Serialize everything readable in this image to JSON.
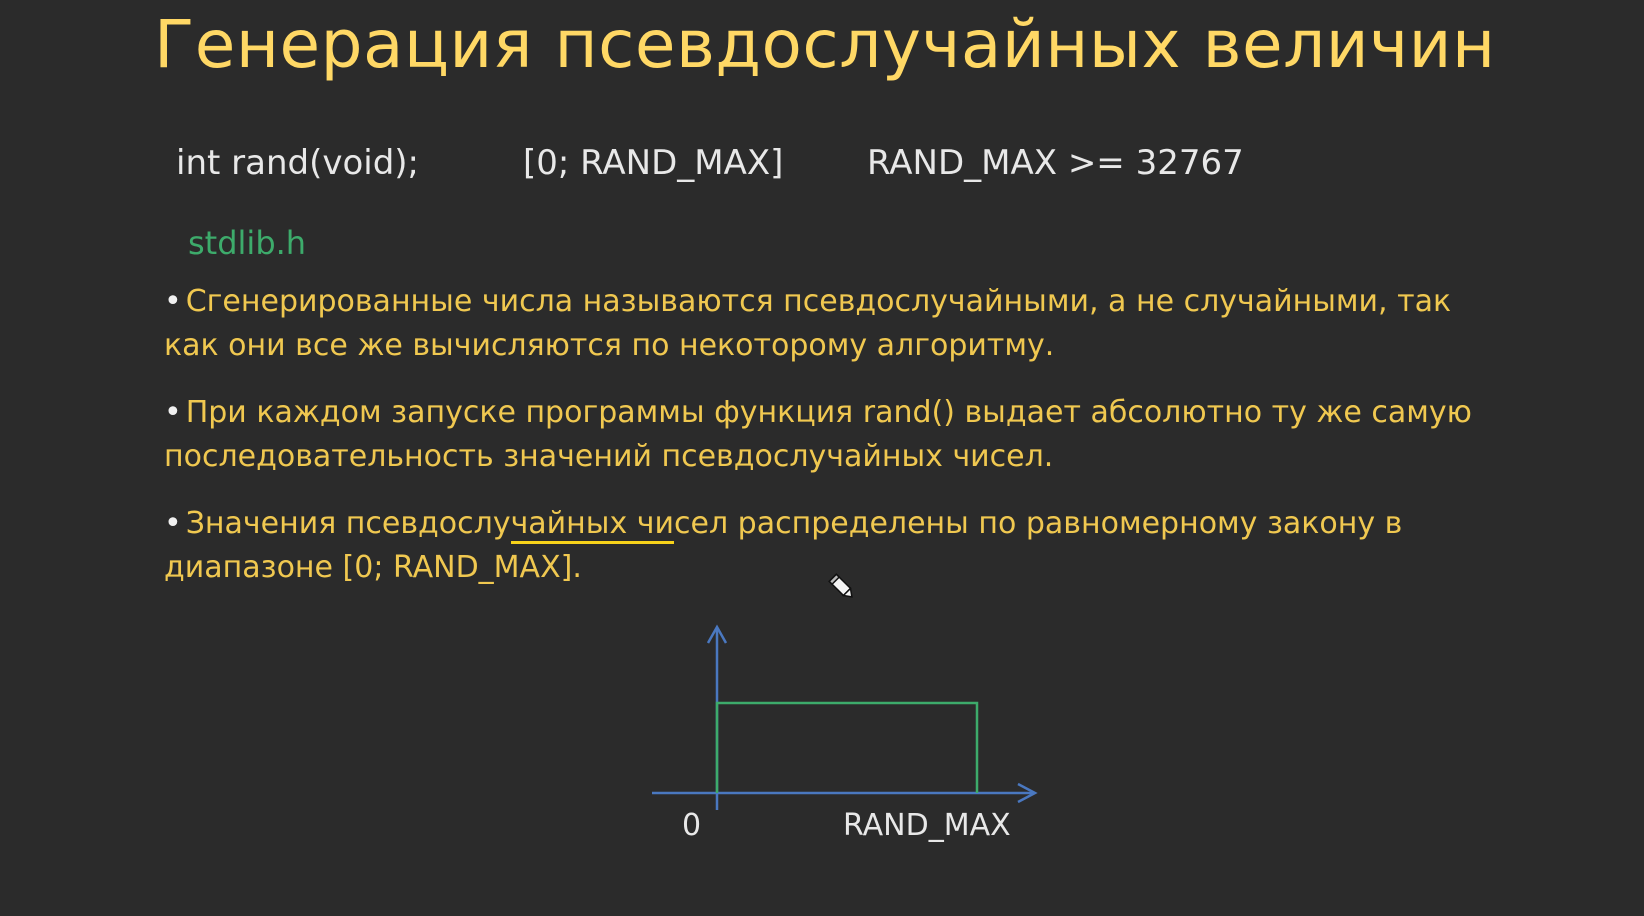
{
  "slide": {
    "title": "Генерация псевдослучайных величин",
    "code": {
      "signature": "int rand(void);",
      "range": "[0; RAND_MAX]",
      "constraint": "RAND_MAX >= 32767"
    },
    "header_file": "stdlib.h",
    "bullets": [
      {
        "text": "Сгенерированные числа называются псевдослучайными, а не случайными, так как они все же вычисляются по некоторому алгоритму."
      },
      {
        "text": "При каждом запуске программы функция rand() выдает абсолютно ту же самую последовательность значений псевдослучайных чисел."
      },
      {
        "before": "Значения псевдослу",
        "highlight": "чайных чи",
        "after": "сел распределены по равномерному закону в диапазоне [0; RAND_MAX]."
      }
    ],
    "graph": {
      "x_start_label": "0",
      "x_end_label": "RAND_MAX"
    }
  },
  "colors": {
    "background": "#2b2b2b",
    "title": "#ffd865",
    "bullet_text": "#f0c850",
    "code_text": "#e8e8e8",
    "header_file": "#3dab6b",
    "axis": "#4a78c0",
    "distribution": "#3dab6b",
    "underline": "#f7d21a"
  },
  "icons": {
    "cursor": "pen-cursor-icon"
  }
}
